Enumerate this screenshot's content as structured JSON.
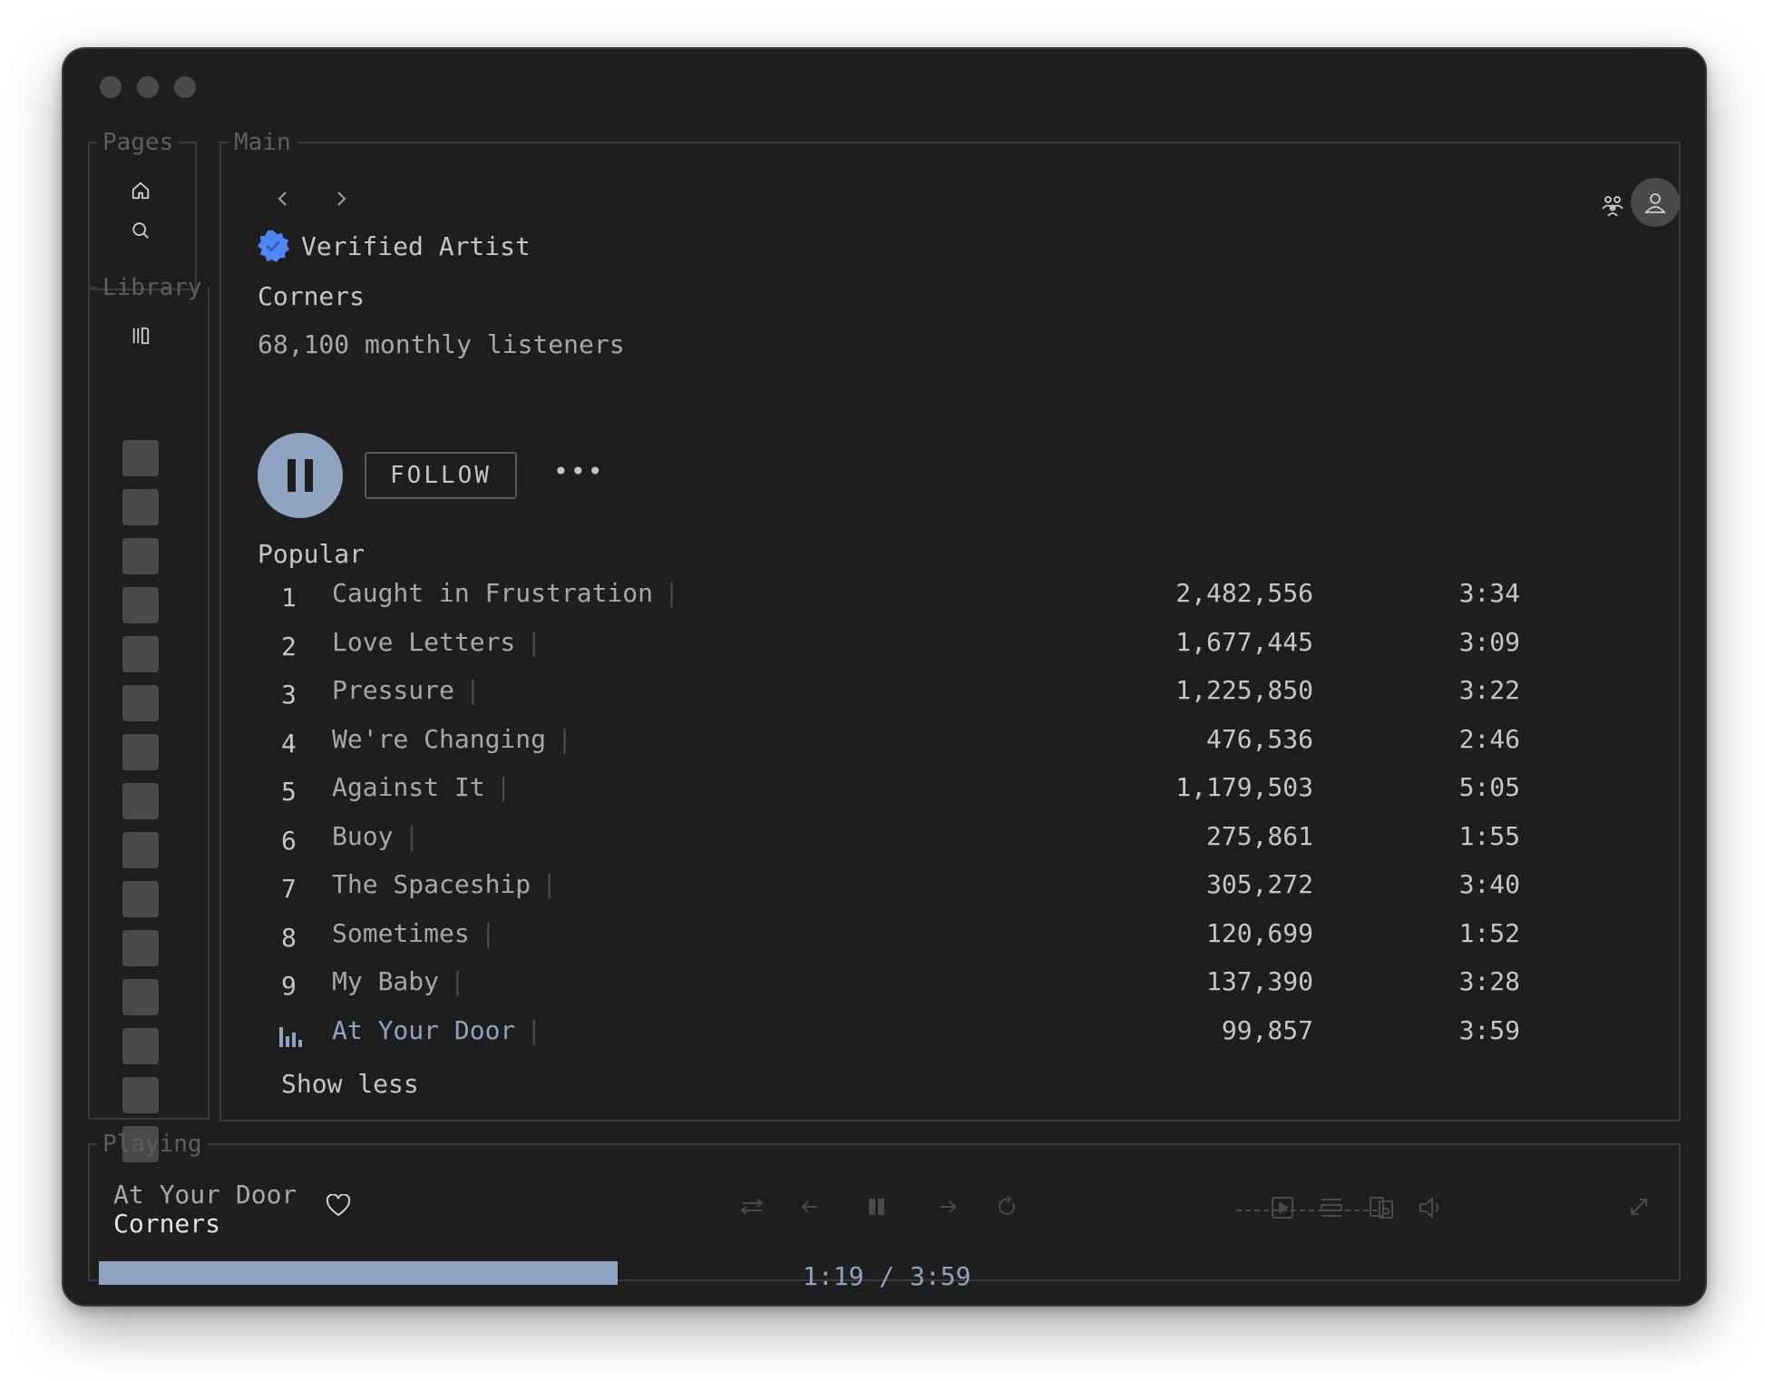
{
  "sections": {
    "pages": "Pages",
    "library": "Library",
    "main": "Main",
    "playing": "Playing"
  },
  "artist": {
    "badge": "Verified Artist",
    "name": "Corners",
    "listeners": "68,100 monthly listeners",
    "follow_label": "FOLLOW",
    "more_label": "•••"
  },
  "popular": {
    "heading": "Popular",
    "tracks": [
      {
        "num": "1",
        "title": "Caught in Frustration",
        "plays": "2,482,556",
        "duration": "3:34"
      },
      {
        "num": "2",
        "title": "Love Letters",
        "plays": "1,677,445",
        "duration": "3:09"
      },
      {
        "num": "3",
        "title": "Pressure",
        "plays": "1,225,850",
        "duration": "3:22"
      },
      {
        "num": "4",
        "title": "We're Changing",
        "plays": "476,536",
        "duration": "2:46"
      },
      {
        "num": "5",
        "title": "Against It",
        "plays": "1,179,503",
        "duration": "5:05"
      },
      {
        "num": "6",
        "title": "Buoy",
        "plays": "275,861",
        "duration": "1:55"
      },
      {
        "num": "7",
        "title": "The Spaceship",
        "plays": "305,272",
        "duration": "3:40"
      },
      {
        "num": "8",
        "title": "Sometimes",
        "plays": "120,699",
        "duration": "1:52"
      },
      {
        "num": "9",
        "title": "My Baby",
        "plays": "137,390",
        "duration": "3:28"
      },
      {
        "num": "",
        "title": "At Your Door",
        "plays": "99,857",
        "duration": "3:59",
        "playing": true
      }
    ],
    "show_less": "Show less"
  },
  "now_playing": {
    "title": "At Your Door",
    "artist": "Corners",
    "time": "1:19 / 3:59",
    "progress": 0.33
  },
  "colors": {
    "accent": "#8fa3c3",
    "background": "#1e1e1e",
    "verified": "#4f86f7"
  },
  "icons": {
    "pages": [
      "home-icon",
      "search-icon"
    ],
    "library": "library-icon",
    "header": [
      "friends-icon",
      "user-avatar-icon"
    ],
    "player": [
      "shuffle-icon",
      "previous-icon",
      "pause-icon",
      "next-icon",
      "repeat-icon"
    ],
    "extras": [
      "now-playing-view-icon",
      "queue-icon",
      "connect-device-icon",
      "volume-icon",
      "fullscreen-icon"
    ]
  }
}
